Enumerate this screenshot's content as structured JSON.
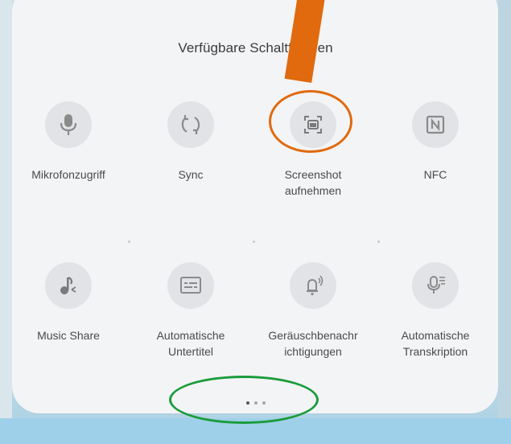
{
  "panel": {
    "title": "Verfügbare Schaltflächen"
  },
  "tiles": [
    {
      "label": "Mikrofonzugriff",
      "icon": "microphone-icon"
    },
    {
      "label": "Sync",
      "icon": "sync-icon"
    },
    {
      "label": "Screenshot\naufnehmen",
      "icon": "screenshot-icon"
    },
    {
      "label": "NFC",
      "icon": "nfc-icon"
    },
    {
      "label": "Music Share",
      "icon": "music-share-icon"
    },
    {
      "label": "Automatische\nUntertitel",
      "icon": "captions-icon"
    },
    {
      "label": "Geräuschbenachr\nichtigungen",
      "icon": "sound-notification-icon"
    },
    {
      "label": "Automatische\nTranskription",
      "icon": "transcription-icon"
    }
  ],
  "pagination": {
    "page_count": 3,
    "current_page": 1
  },
  "colors": {
    "annotation_arrow": "#e06a0d",
    "annotation_highlight": "#e06a0d",
    "annotation_pagination_highlight": "#1a9c3a",
    "icon_gray": "#8a8a8a"
  }
}
